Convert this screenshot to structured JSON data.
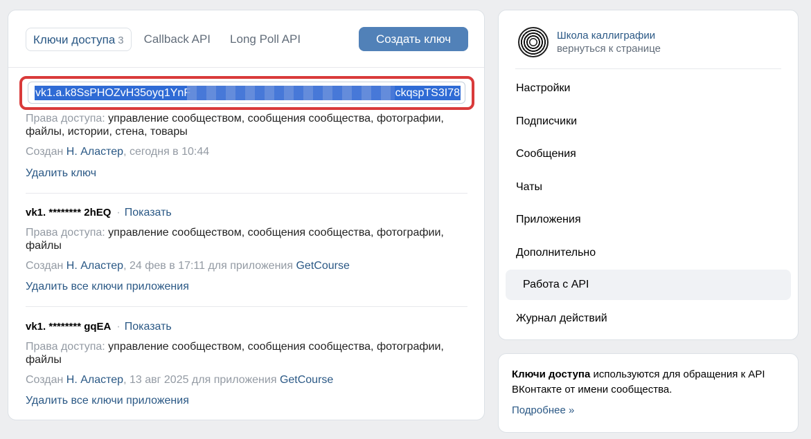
{
  "tabs": [
    {
      "label": "Ключи доступа",
      "count": "3",
      "active": true
    },
    {
      "label": "Callback API"
    },
    {
      "label": "Long Poll API"
    }
  ],
  "create_button": "Создать ключ",
  "new_key": {
    "value_start": "vk1.a.k8SsPHOZvH35oyq1YnF",
    "value_end": "ckqspTS3I78",
    "rights_label": "Права доступа:",
    "rights_value": "управление сообществом, сообщения сообщества, фотографии,",
    "rights_value_2": "файлы, истории, стена, товары",
    "created_prefix": "Создан",
    "created_by": "Н. Аластер",
    "created_time": ", сегодня в 10:44",
    "delete_label": "Удалить ключ"
  },
  "keys": [
    {
      "title": "vk1. ******** 2hEQ",
      "show_label": "Показать",
      "rights_label": "Права доступа:",
      "rights_value": "управление сообществом, сообщения сообщества, фотографии,",
      "rights_value_2": "файлы",
      "created_prefix": "Создан",
      "created_by": "Н. Аластер",
      "created_time": ", 24 фев в 17:11 для приложения",
      "app": "GetCourse",
      "delete_label": "Удалить все ключи приложения"
    },
    {
      "title": "vk1. ******** gqEA",
      "show_label": "Показать",
      "rights_label": "Права доступа:",
      "rights_value": "управление сообществом, сообщения сообщества, фотографии,",
      "rights_value_2": "файлы",
      "created_prefix": "Создан",
      "created_by": "Н. Аластер",
      "created_time": ", 13 авг 2025 для приложения",
      "app": "GetCourse",
      "delete_label": "Удалить все ключи приложения"
    }
  ],
  "community": {
    "name": "Школа каллиграфии",
    "back_label": "вернуться к странице"
  },
  "menu": [
    {
      "label": "Настройки"
    },
    {
      "label": "Подписчики"
    },
    {
      "label": "Сообщения"
    },
    {
      "label": "Чаты"
    },
    {
      "label": "Приложения"
    },
    {
      "label": "Дополнительно"
    },
    {
      "label": "Работа с API",
      "active": true
    },
    {
      "label": "Журнал действий"
    }
  ],
  "info": {
    "bold": "Ключи доступа",
    "text": " используются для обращения к API ВКонтакте от имени сообщества.",
    "more": "Подробнее »"
  },
  "colors": {
    "accent": "#5181b8",
    "link": "#2a5885",
    "highlight_border": "#d93a3a",
    "selection": "#2f6bd5"
  }
}
